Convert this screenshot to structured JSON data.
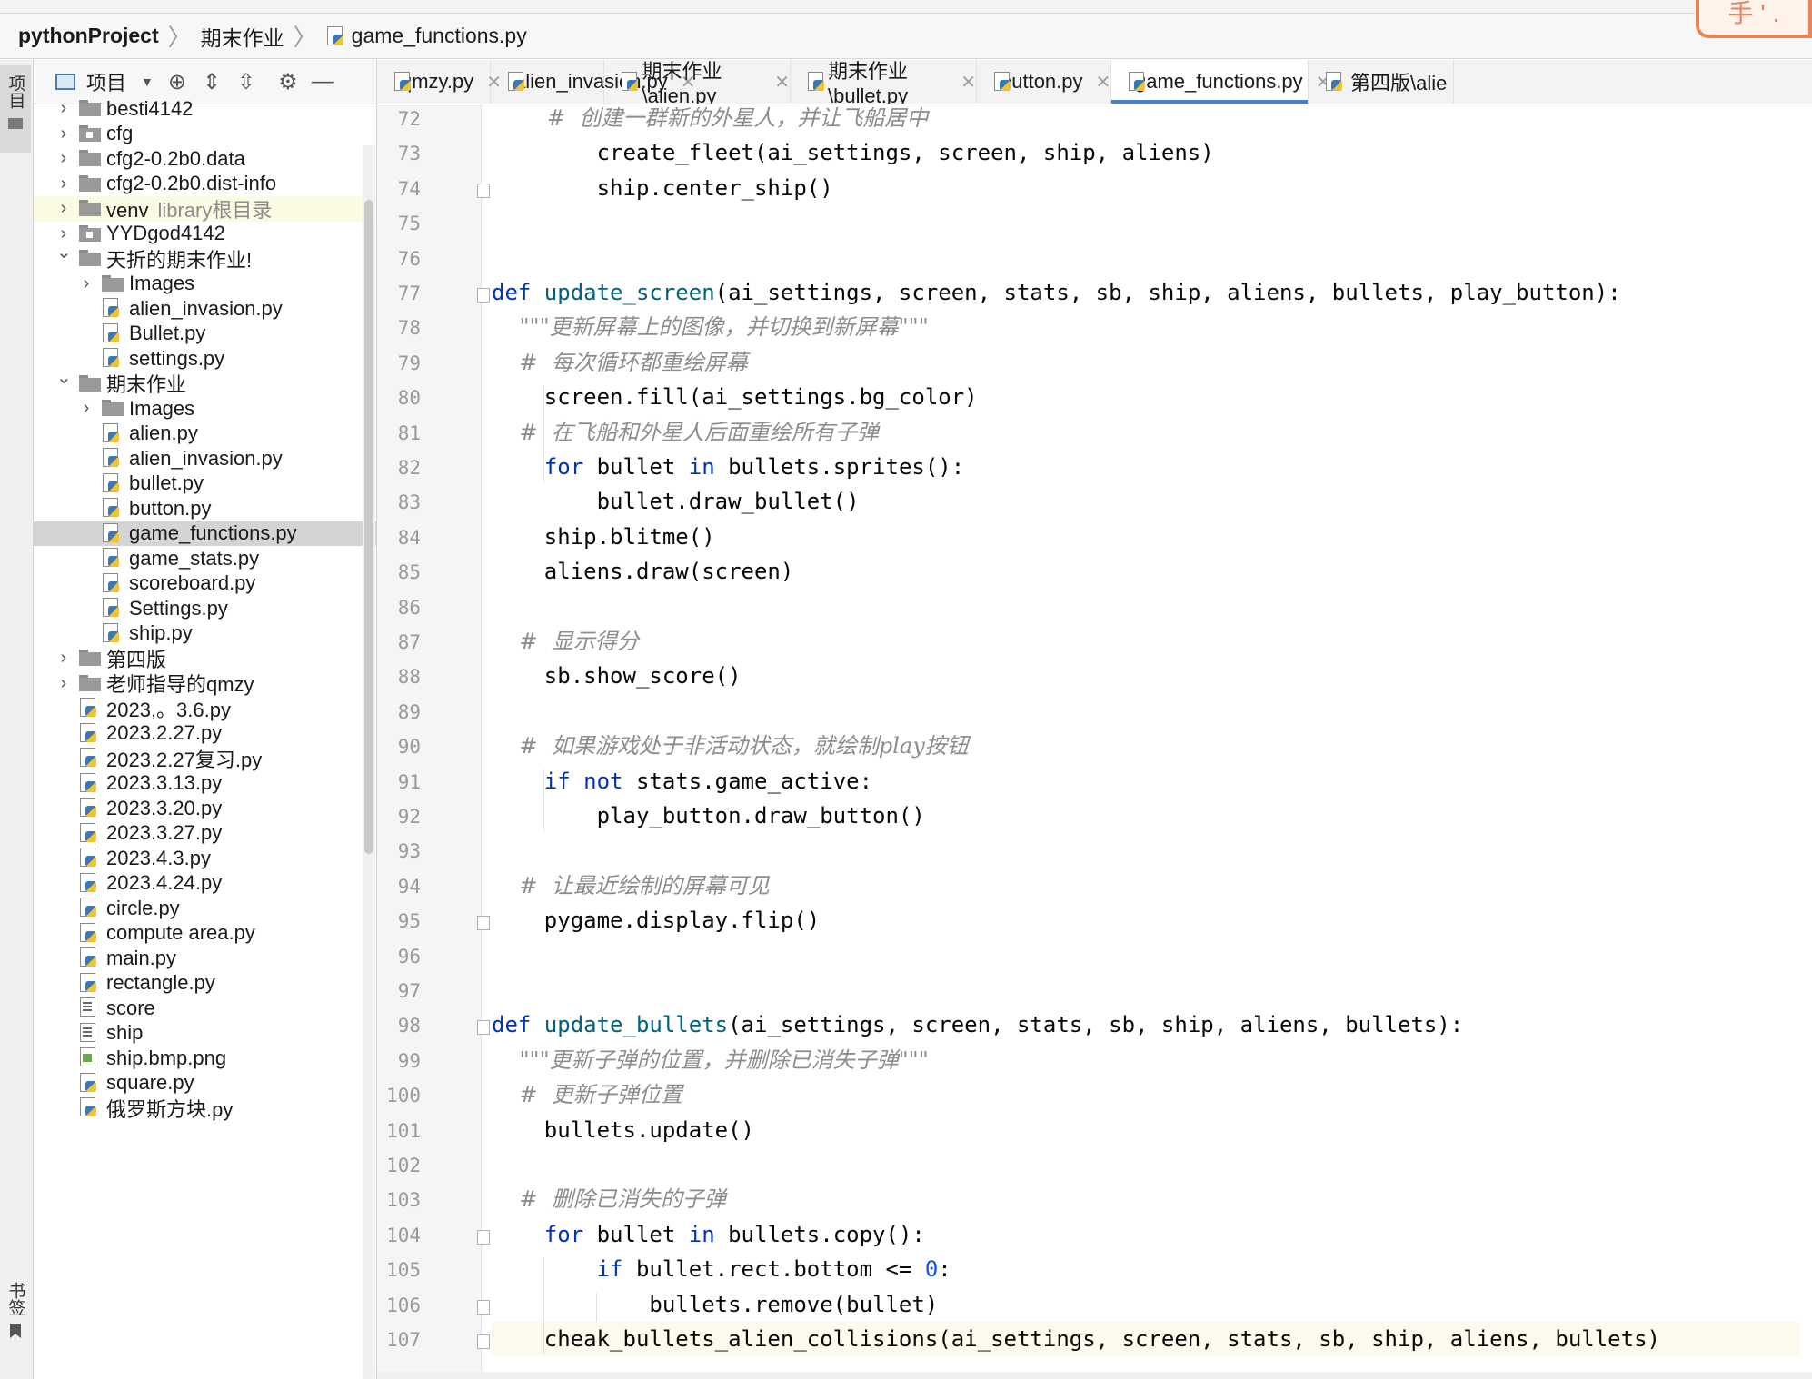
{
  "breadcrumb": {
    "project": "pythonProject",
    "folder": "期末作业",
    "file": "game_functions.py"
  },
  "badge_text": "手 ' .",
  "left_strip": {
    "project_label": "项目",
    "bookmarks_label": "书签"
  },
  "project_panel": {
    "title": "项目",
    "tree": [
      {
        "label": "besti4142",
        "depth": 0,
        "kind": "folder",
        "chevron": "right"
      },
      {
        "label": "cfg",
        "depth": 0,
        "kind": "package",
        "chevron": "right"
      },
      {
        "label": "cfg2-0.2b0.data",
        "depth": 0,
        "kind": "folder",
        "chevron": "right"
      },
      {
        "label": "cfg2-0.2b0.dist-info",
        "depth": 0,
        "kind": "folder",
        "chevron": "right"
      },
      {
        "label": "venv",
        "hint": "library根目录",
        "depth": 0,
        "kind": "folder",
        "chevron": "right",
        "highlight": "venv"
      },
      {
        "label": "YYDgod4142",
        "depth": 0,
        "kind": "package",
        "chevron": "right"
      },
      {
        "label": "天折的期末作业!",
        "depth": 0,
        "kind": "folder",
        "chevron": "down"
      },
      {
        "label": "Images",
        "depth": 1,
        "kind": "folder",
        "chevron": "right"
      },
      {
        "label": "alien_invasion.py",
        "depth": 1,
        "kind": "py"
      },
      {
        "label": "Bullet.py",
        "depth": 1,
        "kind": "py"
      },
      {
        "label": "settings.py",
        "depth": 1,
        "kind": "py"
      },
      {
        "label": "期末作业",
        "depth": 0,
        "kind": "folder",
        "chevron": "down"
      },
      {
        "label": "Images",
        "depth": 1,
        "kind": "folder",
        "chevron": "right"
      },
      {
        "label": "alien.py",
        "depth": 1,
        "kind": "py"
      },
      {
        "label": "alien_invasion.py",
        "depth": 1,
        "kind": "py"
      },
      {
        "label": "bullet.py",
        "depth": 1,
        "kind": "py"
      },
      {
        "label": "button.py",
        "depth": 1,
        "kind": "py"
      },
      {
        "label": "game_functions.py",
        "depth": 1,
        "kind": "py",
        "selected": true
      },
      {
        "label": "game_stats.py",
        "depth": 1,
        "kind": "py"
      },
      {
        "label": "scoreboard.py",
        "depth": 1,
        "kind": "py"
      },
      {
        "label": "Settings.py",
        "depth": 1,
        "kind": "py"
      },
      {
        "label": "ship.py",
        "depth": 1,
        "kind": "py"
      },
      {
        "label": "第四版",
        "depth": 0,
        "kind": "folder",
        "chevron": "right"
      },
      {
        "label": "老师指导的qmzy",
        "depth": 0,
        "kind": "folder",
        "chevron": "right"
      },
      {
        "label": "2023,。3.6.py",
        "depth": 0,
        "kind": "py",
        "root_file": true
      },
      {
        "label": "2023.2.27.py",
        "depth": 0,
        "kind": "py",
        "root_file": true
      },
      {
        "label": "2023.2.27复习.py",
        "depth": 0,
        "kind": "py",
        "root_file": true
      },
      {
        "label": "2023.3.13.py",
        "depth": 0,
        "kind": "py",
        "root_file": true
      },
      {
        "label": "2023.3.20.py",
        "depth": 0,
        "kind": "py",
        "root_file": true
      },
      {
        "label": "2023.3.27.py",
        "depth": 0,
        "kind": "py",
        "root_file": true
      },
      {
        "label": "2023.4.3.py",
        "depth": 0,
        "kind": "py",
        "root_file": true
      },
      {
        "label": "2023.4.24.py",
        "depth": 0,
        "kind": "py",
        "root_file": true
      },
      {
        "label": "circle.py",
        "depth": 0,
        "kind": "py",
        "root_file": true
      },
      {
        "label": "compute area.py",
        "depth": 0,
        "kind": "py",
        "root_file": true
      },
      {
        "label": "main.py",
        "depth": 0,
        "kind": "py",
        "root_file": true
      },
      {
        "label": "rectangle.py",
        "depth": 0,
        "kind": "py",
        "root_file": true
      },
      {
        "label": "score",
        "depth": 0,
        "kind": "txt",
        "root_file": true
      },
      {
        "label": "ship",
        "depth": 0,
        "kind": "txt",
        "root_file": true
      },
      {
        "label": "ship.bmp.png",
        "depth": 0,
        "kind": "img",
        "root_file": true
      },
      {
        "label": "square.py",
        "depth": 0,
        "kind": "py",
        "root_file": true
      },
      {
        "label": "俄罗斯方块.py",
        "depth": 0,
        "kind": "py",
        "root_file": true
      }
    ]
  },
  "tabs": [
    {
      "label": "qmzy.py",
      "active": false
    },
    {
      "label": "alien_invasion.py",
      "active": false
    },
    {
      "label": "期末作业\\alien.py",
      "active": false
    },
    {
      "label": "期末作业\\bullet.py",
      "active": false
    },
    {
      "label": "button.py",
      "active": false
    },
    {
      "label": "game_functions.py",
      "active": true
    },
    {
      "label": "第四版\\alie",
      "active": false
    }
  ],
  "editor": {
    "current_line": 107,
    "lines": [
      {
        "n": "72",
        "parts": [
          [
            "cm",
            "        #  创建一群新的外星人，并让飞船居中"
          ]
        ]
      },
      {
        "n": "73",
        "parts": [
          [
            "",
            "        create_fleet(ai_settings, screen, ship, aliens)"
          ]
        ]
      },
      {
        "n": "74",
        "parts": [
          [
            "",
            "        ship.center_ship()"
          ]
        ],
        "fold": true
      },
      {
        "n": "75",
        "parts": []
      },
      {
        "n": "76",
        "parts": []
      },
      {
        "n": "77",
        "parts": [
          [
            "kw",
            "def "
          ],
          [
            "fn",
            "update_screen"
          ],
          [
            "",
            "(ai_settings, screen, stats, sb, ship, aliens, bullets, play_button):"
          ]
        ],
        "fold": true
      },
      {
        "n": "78",
        "parts": [
          [
            "cm",
            "    \"\"\"更新屏幕上的图像，并切换到新屏幕\"\"\""
          ]
        ]
      },
      {
        "n": "79",
        "parts": [
          [
            "cm",
            "    #  每次循环都重绘屏幕"
          ]
        ]
      },
      {
        "n": "80",
        "parts": [
          [
            "",
            "    screen.fill(ai_settings.bg_color)"
          ]
        ]
      },
      {
        "n": "81",
        "parts": [
          [
            "cm",
            "    #  在飞船和外星人后面重绘所有子弹"
          ]
        ]
      },
      {
        "n": "82",
        "parts": [
          [
            "kw",
            "    for "
          ],
          [
            "",
            "bullet "
          ],
          [
            "kw",
            "in "
          ],
          [
            "",
            "bullets.sprites():"
          ]
        ]
      },
      {
        "n": "83",
        "parts": [
          [
            "",
            "        bullet.draw_bullet()"
          ]
        ]
      },
      {
        "n": "84",
        "parts": [
          [
            "",
            "    ship.blitme()"
          ]
        ]
      },
      {
        "n": "85",
        "parts": [
          [
            "",
            "    aliens.draw(screen)"
          ]
        ]
      },
      {
        "n": "86",
        "parts": []
      },
      {
        "n": "87",
        "parts": [
          [
            "cm",
            "    #  显示得分"
          ]
        ]
      },
      {
        "n": "88",
        "parts": [
          [
            "",
            "    sb.show_score()"
          ]
        ]
      },
      {
        "n": "89",
        "parts": []
      },
      {
        "n": "90",
        "parts": [
          [
            "cm",
            "    #  如果游戏处于非活动状态，就绘制play按钮"
          ]
        ]
      },
      {
        "n": "91",
        "parts": [
          [
            "kw",
            "    if not "
          ],
          [
            "",
            "stats.game_active:"
          ]
        ]
      },
      {
        "n": "92",
        "parts": [
          [
            "",
            "        play_button.draw_button()"
          ]
        ]
      },
      {
        "n": "93",
        "parts": []
      },
      {
        "n": "94",
        "parts": [
          [
            "cm",
            "    #  让最近绘制的屏幕可见"
          ]
        ]
      },
      {
        "n": "95",
        "parts": [
          [
            "",
            "    pygame.display.flip()"
          ]
        ],
        "fold": true
      },
      {
        "n": "96",
        "parts": []
      },
      {
        "n": "97",
        "parts": []
      },
      {
        "n": "98",
        "parts": [
          [
            "kw",
            "def "
          ],
          [
            "fn",
            "update_bullets"
          ],
          [
            "",
            "(ai_settings, screen, stats, sb, ship, aliens, bullets):"
          ]
        ],
        "fold": true
      },
      {
        "n": "99",
        "parts": [
          [
            "cm",
            "    \"\"\"更新子弹的位置，并删除已消失子弹\"\"\""
          ]
        ]
      },
      {
        "n": "100",
        "parts": [
          [
            "cm",
            "    #  更新子弹位置"
          ]
        ]
      },
      {
        "n": "101",
        "parts": [
          [
            "",
            "    bullets.update()"
          ]
        ]
      },
      {
        "n": "102",
        "parts": []
      },
      {
        "n": "103",
        "parts": [
          [
            "cm",
            "    #  删除已消失的子弹"
          ]
        ]
      },
      {
        "n": "104",
        "parts": [
          [
            "kw",
            "    for "
          ],
          [
            "",
            "bullet "
          ],
          [
            "kw",
            "in "
          ],
          [
            "",
            "bullets.copy():"
          ]
        ],
        "fold": true
      },
      {
        "n": "105",
        "parts": [
          [
            "kw",
            "        if "
          ],
          [
            "",
            "bullet.rect.bottom <= "
          ],
          [
            "num",
            "0"
          ],
          [
            "",
            ":"
          ]
        ]
      },
      {
        "n": "106",
        "parts": [
          [
            "",
            "            bullets.remove(bullet)"
          ]
        ],
        "fold": true
      },
      {
        "n": "107",
        "parts": [
          [
            "",
            "    cheak_bullets_alien_collisions(ai_settings, screen, stats, sb, ship, aliens, bullets)"
          ]
        ],
        "fold": true
      }
    ]
  }
}
